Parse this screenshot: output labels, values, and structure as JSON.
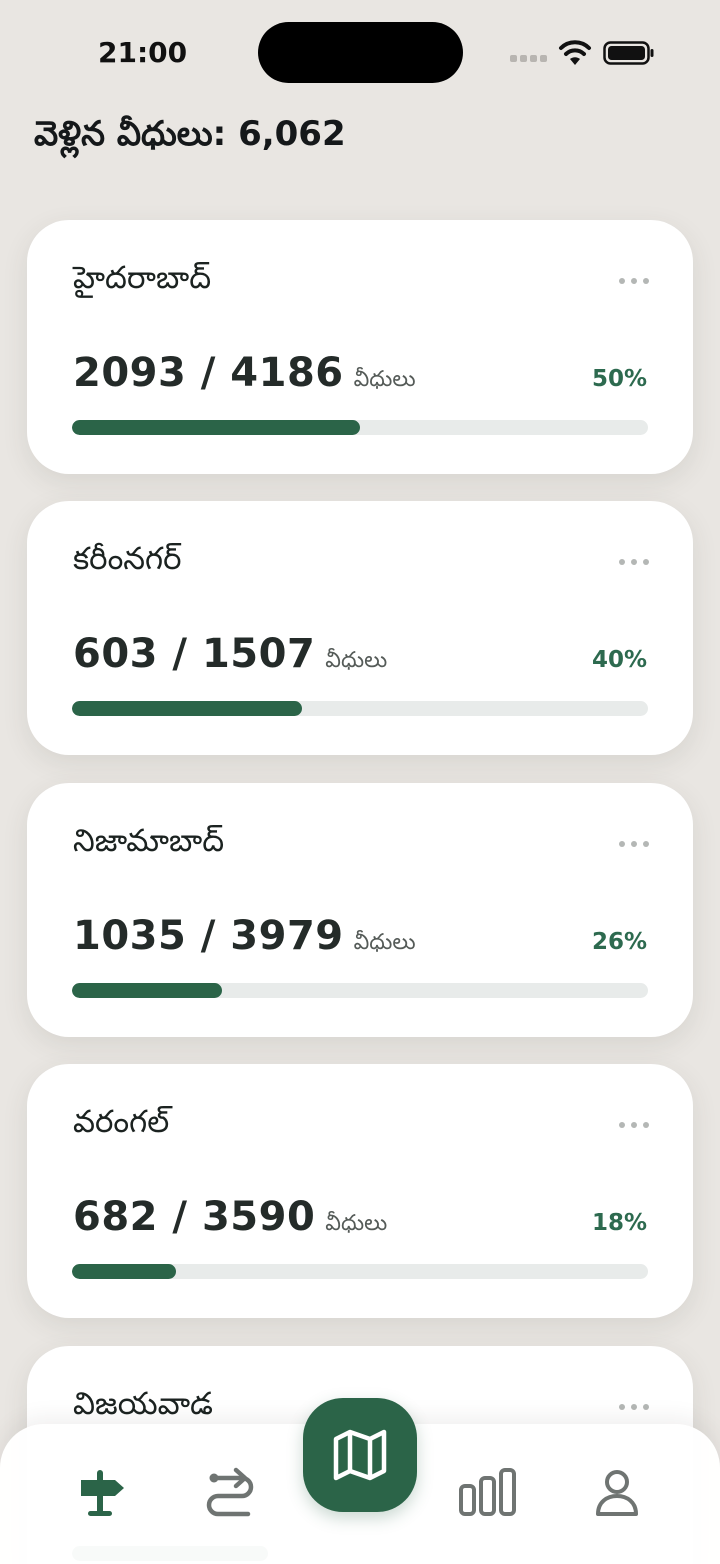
{
  "status_bar": {
    "time": "21:00"
  },
  "header": {
    "title": "వెళ్లిన వీధులు: 6,062"
  },
  "cities": [
    {
      "name": "హైదరాబాద్",
      "visited": 2093,
      "total": 4186,
      "count_text": "2093 / 4186",
      "unit": "వీధులు",
      "percent_label": "50%",
      "progress": 0.5
    },
    {
      "name": "కరీంనగర్",
      "visited": 603,
      "total": 1507,
      "count_text": "603 / 1507",
      "unit": "వీధులు",
      "percent_label": "40%",
      "progress": 0.4
    },
    {
      "name": "నిజామాబాద్",
      "visited": 1035,
      "total": 3979,
      "count_text": "1035 / 3979",
      "unit": "వీధులు",
      "percent_label": "26%",
      "progress": 0.26
    },
    {
      "name": "వరంగల్",
      "visited": 682,
      "total": 3590,
      "count_text": "682 / 3590",
      "unit": "వీధులు",
      "percent_label": "18%",
      "progress": 0.18
    },
    {
      "name": "విజయవాడ",
      "count_text": "",
      "unit": "",
      "percent_label": "",
      "progress": 0.34
    }
  ],
  "tabs": [
    {
      "id": "places",
      "icon": "signpost-icon",
      "active": true
    },
    {
      "id": "routes",
      "icon": "route-icon",
      "active": false
    },
    {
      "id": "map",
      "icon": "map-icon",
      "active": false
    },
    {
      "id": "stats",
      "icon": "bar-chart-icon",
      "active": false
    },
    {
      "id": "profile",
      "icon": "user-icon",
      "active": false
    }
  ],
  "colors": {
    "accent": "#2b6448",
    "percent_text": "#2d6a4f",
    "track": "#e8ebea",
    "background": "#e9e6e2"
  }
}
